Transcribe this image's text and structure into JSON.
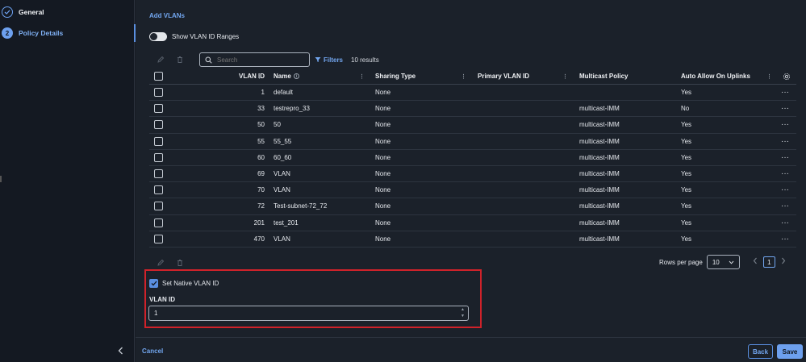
{
  "sidebar": {
    "steps": [
      {
        "label": "General",
        "status": "done"
      },
      {
        "label": "Policy Details",
        "number": "2",
        "status": "active"
      }
    ],
    "collapse_icon": "chevron-left-icon"
  },
  "main": {
    "add_vlans_label": "Add VLANs",
    "show_ranges_label": "Show VLAN ID Ranges",
    "show_ranges_enabled": false,
    "search": {
      "placeholder": "Search",
      "value": ""
    },
    "filters_label": "Filters",
    "results_label": "10 results"
  },
  "table": {
    "columns": [
      "VLAN ID",
      "Name",
      "Sharing Type",
      "Primary VLAN ID",
      "Multicast Policy",
      "Auto Allow On Uplinks"
    ],
    "rows": [
      {
        "id": "1",
        "name": "default",
        "sharing": "None",
        "primary": "",
        "mcast": "",
        "allow": "Yes"
      },
      {
        "id": "33",
        "name": "testrepro_33",
        "sharing": "None",
        "primary": "",
        "mcast": "multicast-IMM",
        "allow": "No"
      },
      {
        "id": "50",
        "name": "50",
        "sharing": "None",
        "primary": "",
        "mcast": "multicast-IMM",
        "allow": "Yes"
      },
      {
        "id": "55",
        "name": "55_55",
        "sharing": "None",
        "primary": "",
        "mcast": "multicast-IMM",
        "allow": "Yes"
      },
      {
        "id": "60",
        "name": "60_60",
        "sharing": "None",
        "primary": "",
        "mcast": "multicast-IMM",
        "allow": "Yes"
      },
      {
        "id": "69",
        "name": "VLAN",
        "sharing": "None",
        "primary": "",
        "mcast": "multicast-IMM",
        "allow": "Yes"
      },
      {
        "id": "70",
        "name": "VLAN",
        "sharing": "None",
        "primary": "",
        "mcast": "multicast-IMM",
        "allow": "Yes"
      },
      {
        "id": "72",
        "name": "Test-subnet-72_72",
        "sharing": "None",
        "primary": "",
        "mcast": "multicast-IMM",
        "allow": "Yes"
      },
      {
        "id": "201",
        "name": "test_201",
        "sharing": "None",
        "primary": "",
        "mcast": "multicast-IMM",
        "allow": "Yes"
      },
      {
        "id": "470",
        "name": "VLAN",
        "sharing": "None",
        "primary": "",
        "mcast": "multicast-IMM",
        "allow": "Yes"
      }
    ]
  },
  "pagination": {
    "rows_per_page_label": "Rows per page",
    "rows_per_page": "10",
    "current_page": "1"
  },
  "native_vlan": {
    "checkbox_label": "Set Native VLAN ID",
    "checked": true,
    "field_label": "VLAN ID",
    "value": "1"
  },
  "footer": {
    "cancel_label": "Cancel",
    "back_label": "Back",
    "save_label": "Save"
  },
  "colors": {
    "accent": "#6da0ee",
    "background": "#1b212a",
    "highlight_border": "#d0222a"
  }
}
